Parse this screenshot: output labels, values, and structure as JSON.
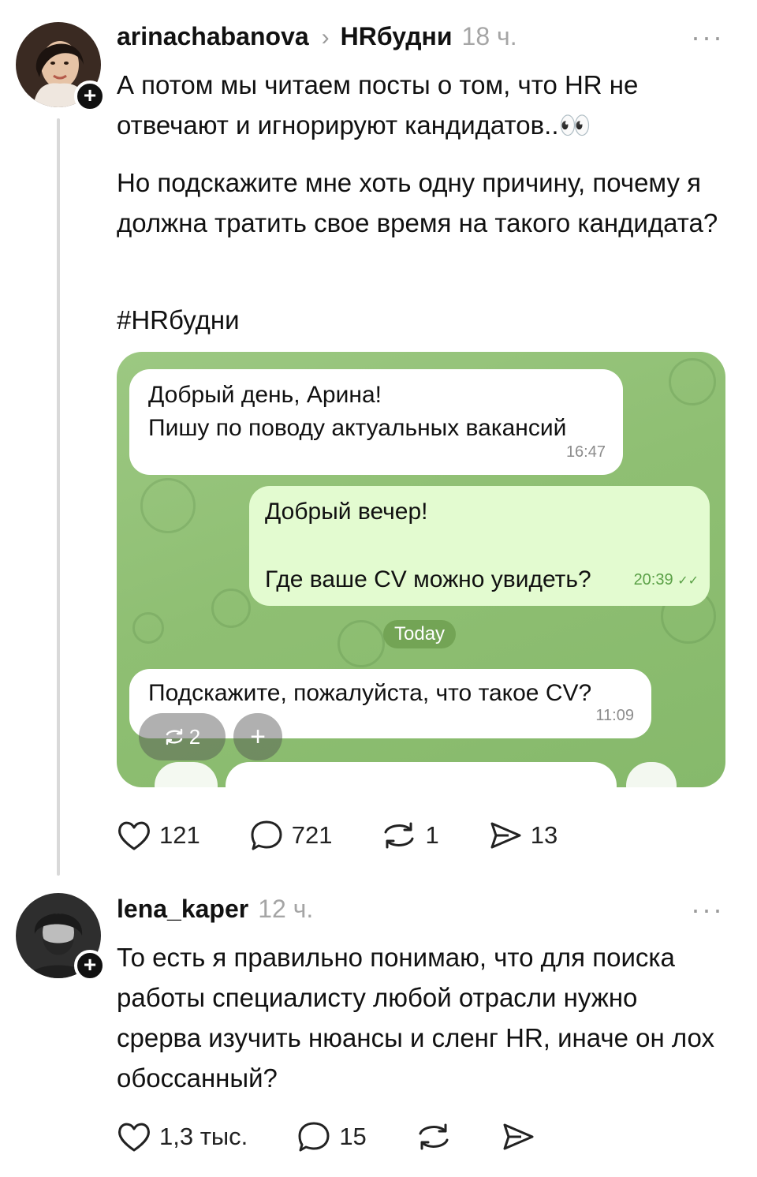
{
  "post1": {
    "username": "arinachabanova",
    "chevron": "›",
    "community": "HRбудни",
    "time": "18 ч.",
    "more": "···",
    "follow": "+",
    "paragraphs": [
      "А потом мы читаем посты о том, что HR не отвечают и игнорируют кандидатов..👀",
      "Но подскажите мне хоть одну причину, почему я должна тратить свое время на такого кандидата?",
      "#HRбудни"
    ],
    "chat": {
      "msg1_line1": "Добрый день, Арина!",
      "msg1_line2": "Пишу по поводу актуальных вакансий",
      "msg1_time": "16:47",
      "msg2_line1": "Добрый вечер!",
      "msg2_line2": "Где ваше CV можно увидеть?",
      "msg2_time": "20:39",
      "msg2_check": "✓✓",
      "today": "Today",
      "msg3": "Подскажите, пожалуйста, что такое CV?",
      "msg3_time": "11:09",
      "repost_pill": "2",
      "add_pill": "+"
    },
    "stats": {
      "likes": "121",
      "comments": "721",
      "reposts": "1",
      "shares": "13"
    }
  },
  "post2": {
    "username": "lena_kaper",
    "time": "12 ч.",
    "more": "···",
    "follow": "+",
    "text": "То есть я правильно понимаю, что для поиска работы специалисту любой отрасли нужно срерва изучить нюансы и сленг HR, иначе он лох обоссанный?",
    "stats": {
      "likes": "1,3 тыс.",
      "comments": "15"
    }
  },
  "icons": [
    "heart-icon",
    "comment-icon",
    "repost-icon",
    "share-icon",
    "more-icon"
  ]
}
